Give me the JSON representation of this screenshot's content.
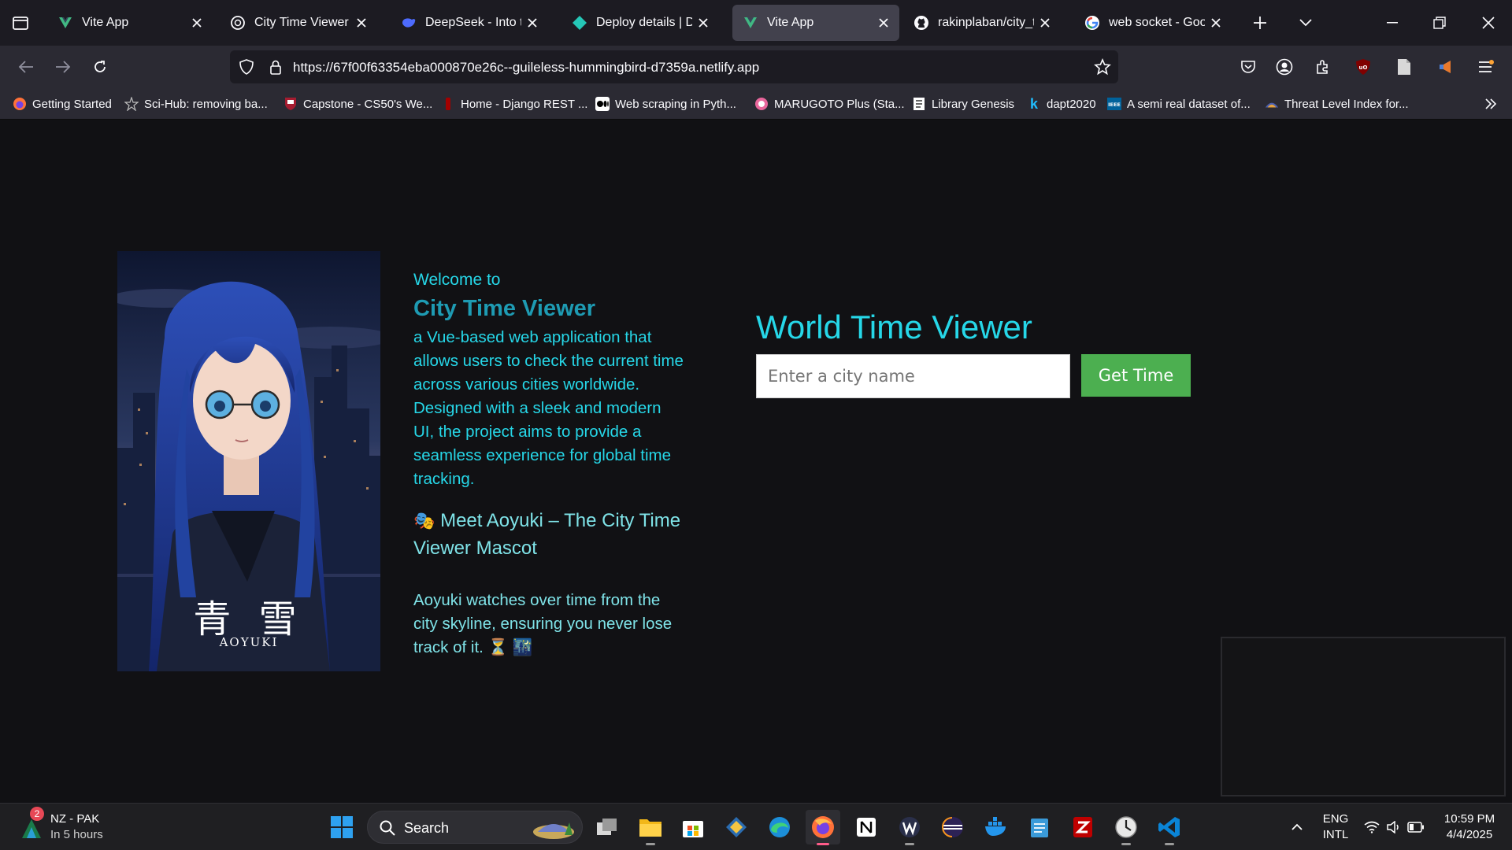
{
  "browser": {
    "tabs": [
      {
        "title": "Vite App",
        "icon": "vite-icon",
        "active": false
      },
      {
        "title": "City Time Viewer App",
        "icon": "openai-icon",
        "active": false
      },
      {
        "title": "DeepSeek - Into the U",
        "icon": "deepseek-icon",
        "active": false
      },
      {
        "title": "Deploy details | Depl",
        "icon": "netlify-icon",
        "active": false
      },
      {
        "title": "Vite App",
        "icon": "vite-icon",
        "active": true
      },
      {
        "title": "rakinplaban/city_time",
        "icon": "github-icon",
        "active": false
      },
      {
        "title": "web socket - Google",
        "icon": "google-icon",
        "active": false
      }
    ],
    "url_main": "https://67f00f63354eba000870e26c--guileless-hummingbird-d7359a.netlify.app",
    "bookmarks": [
      {
        "label": "Getting Started",
        "icon": "firefox-icon"
      },
      {
        "label": "Sci-Hub: removing ba...",
        "icon": "scihub-icon"
      },
      {
        "label": "Capstone - CS50's We...",
        "icon": "harvard-icon"
      },
      {
        "label": "Home - Django REST ...",
        "icon": "django-icon"
      },
      {
        "label": "Web scraping in Pyth...",
        "icon": "medium-icon"
      },
      {
        "label": "MARUGOTO Plus (Sta...",
        "icon": "marugoto-icon"
      },
      {
        "label": "Library Genesis",
        "icon": "libgen-icon"
      },
      {
        "label": "dapt2020",
        "icon": "kaggle-icon"
      },
      {
        "label": "A semi real dataset of...",
        "icon": "ieee-icon"
      },
      {
        "label": "Threat Level Index for...",
        "icon": "threat-icon"
      }
    ]
  },
  "page": {
    "mascot": {
      "kanji": "青 雪",
      "name": "AOYUKI"
    },
    "welcome": "Welcome to",
    "app_title": "City Time Viewer",
    "description": "a Vue-based web application that allows users to check the current time across various cities worldwide. Designed with a sleek and modern UI, the project aims to provide a seamless experience for global time tracking.",
    "meet_emoji": "🎭",
    "meet": "Meet Aoyuki – The City Time Viewer Mascot",
    "aoyuki_text": "Aoyuki watches over time from the city skyline, ensuring you never lose track of it. ⏳ 🌃",
    "viewer_title": "World Time Viewer",
    "city_placeholder": "Enter a city name",
    "get_time_label": "Get Time"
  },
  "taskbar": {
    "weather_title": "NZ - PAK",
    "weather_sub": "In 5 hours",
    "weather_badge": "2",
    "search_label": "Search",
    "lang_line1": "ENG",
    "lang_line2": "INTL",
    "time": "10:59 PM",
    "date": "4/4/2025"
  },
  "colors": {
    "accent_cyan": "#26d7e8",
    "title_teal": "#1e9bb3",
    "button_green": "#4caf50",
    "active_tab": "#42414d"
  }
}
